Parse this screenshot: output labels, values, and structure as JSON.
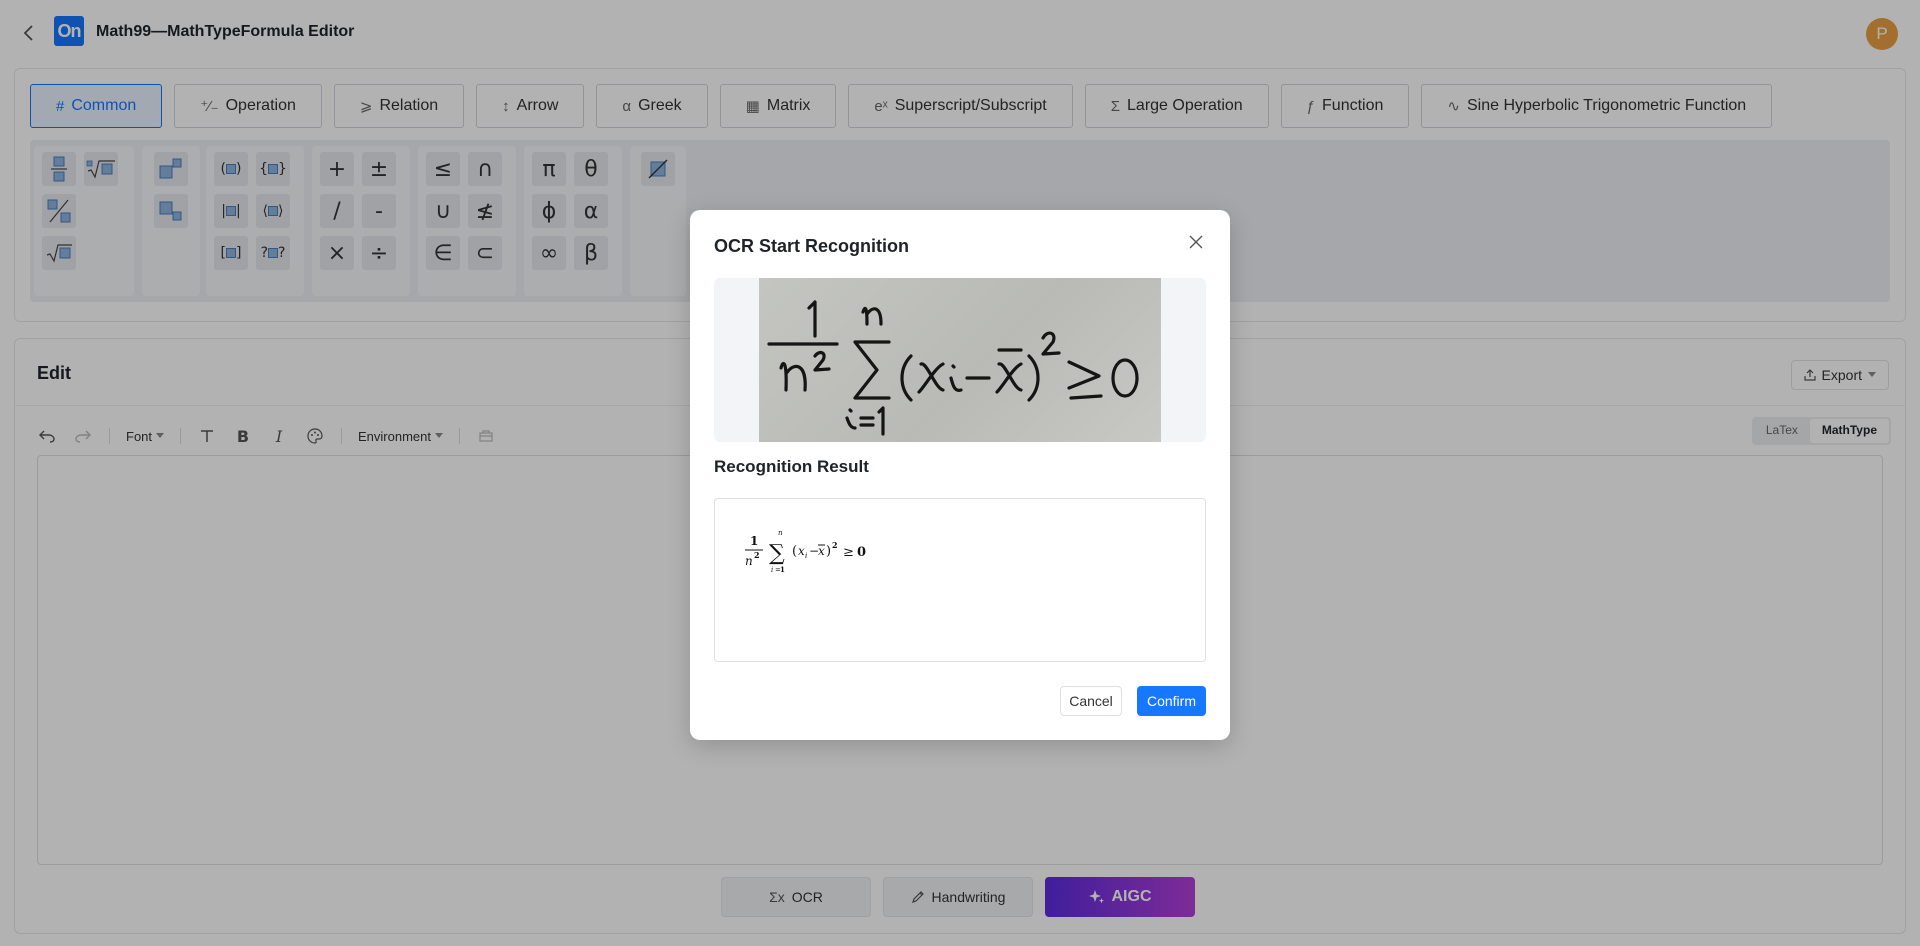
{
  "header": {
    "back_icon": "chevron-left-icon",
    "logo_text": "On",
    "title": "Math99—MathTypeFormula Editor",
    "avatar_letter": "P",
    "avatar_color": "#e8a042"
  },
  "symbol_panel": {
    "tabs": [
      {
        "icon": "#",
        "label": "Common",
        "active": true
      },
      {
        "icon": "⁺⁄₋",
        "label": "Operation"
      },
      {
        "icon": "⩾",
        "label": "Relation"
      },
      {
        "icon": "↕",
        "label": "Arrow"
      },
      {
        "icon": "α",
        "label": "Greek"
      },
      {
        "icon": "▦",
        "label": "Matrix"
      },
      {
        "icon": "eˣ",
        "label": "Superscript/Subscript"
      },
      {
        "icon": "Σ",
        "label": "Large Operation"
      },
      {
        "icon": "ƒ",
        "label": "Function"
      },
      {
        "icon": "∿",
        "label": "Sine Hyperbolic Trigonometric Function"
      }
    ],
    "operators": {
      "plus": "+",
      "plus_minus": "±",
      "slash": "/",
      "minus": "-",
      "times": "×",
      "divide": "÷"
    },
    "relations": {
      "leq": "≤",
      "cap": "∩",
      "cup": "∪",
      "not_leq": "≰",
      "in": "∈",
      "subset": "⊂"
    },
    "greek": {
      "pi": "π",
      "theta": "θ",
      "phi": "ϕ",
      "alpha": "α",
      "infinity": "∞",
      "beta": "β"
    },
    "accent_color": "#1677ff"
  },
  "edit": {
    "title": "Edit",
    "export_label": "Export",
    "font_label": "Font",
    "environment_label": "Environment",
    "mode_latex": "LaTex",
    "mode_mathtype": "MathType",
    "ocr_label": "OCR",
    "handwriting_label": "Handwriting",
    "aigc_label": "AIGC"
  },
  "modal": {
    "title": "OCR Start Recognition",
    "result_title": "Recognition Result",
    "cancel_label": "Cancel",
    "confirm_label": "Confirm",
    "confirm_color": "#1677ff"
  }
}
